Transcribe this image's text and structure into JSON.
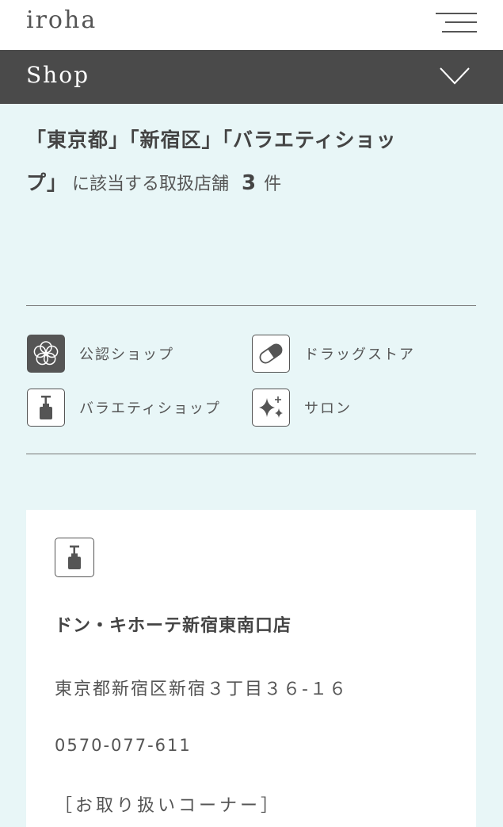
{
  "header": {
    "logo": "iroha",
    "menu_icon": "hamburger-menu-icon"
  },
  "shop_bar": {
    "title": "Shop",
    "toggle_icon": "chevron-down-icon"
  },
  "result": {
    "conditions_line1": "「東京都」「新宿区」「バラエティショッ",
    "conditions_line2": "プ」",
    "label": "に該当する取扱店舗",
    "count": "3",
    "unit": "件"
  },
  "legend": [
    {
      "label": "公認ショップ",
      "icon": "flower-icon"
    },
    {
      "label": "ドラッグストア",
      "icon": "capsule-icon"
    },
    {
      "label": "バラエティショップ",
      "icon": "pump-bottle-icon"
    },
    {
      "label": "サロン",
      "icon": "sparkle-icon"
    }
  ],
  "store": {
    "icon": "pump-bottle-icon",
    "name": "ドン・キホーテ新宿東南口店",
    "address": "東京都新宿区新宿３丁目３６-１６",
    "tel": "0570-077-611",
    "corner_label": "［お取り扱いコーナー］"
  },
  "colors": {
    "background": "#e8f6f7",
    "bar": "#4a4a4a",
    "text": "#4a4a4a",
    "card": "#ffffff"
  }
}
